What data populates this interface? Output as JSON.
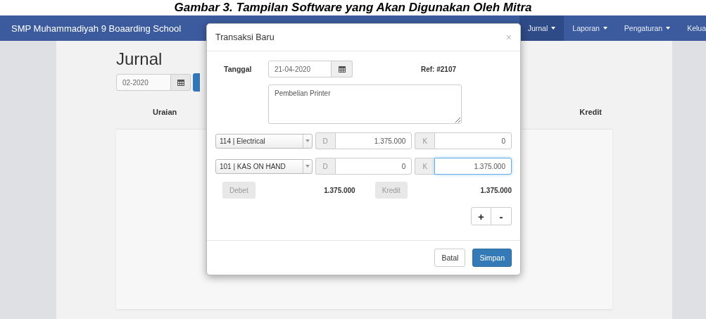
{
  "caption": "Gambar 3. Tampilan Software yang Akan Digunakan Oleh Mitra",
  "navbar": {
    "brand": "SMP Muhammadiyah 9 Boaarding School",
    "items": [
      {
        "label": "Jurnal",
        "caret": true,
        "selected": true
      },
      {
        "label": "Laporan",
        "caret": true,
        "selected": false
      },
      {
        "label": "Pengaturan",
        "caret": true,
        "selected": false
      },
      {
        "label": "Kelua",
        "caret": false,
        "selected": false
      }
    ]
  },
  "page": {
    "title": "Jurnal",
    "period": "02-2020",
    "columns": [
      "Uraian",
      "Kredit"
    ]
  },
  "modal": {
    "title": "Transaksi Baru",
    "close": "×",
    "date_label": "Tanggal",
    "date": "21-04-2020",
    "ref": "Ref: #2107",
    "description": "Pembelian Printer",
    "entries": [
      {
        "account": "114 | Electrical",
        "debit_label": "D",
        "debit": "1.375.000",
        "credit_label": "K",
        "credit": "0",
        "focused": false
      },
      {
        "account": "101 | KAS ON HAND",
        "debit_label": "D",
        "debit": "0",
        "credit_label": "K",
        "credit": "1.375.000",
        "focused": true
      }
    ],
    "totals": {
      "debit_button": {
        "label": "Debet",
        "disabled": true
      },
      "debit_total": "1.375.000",
      "credit_button": {
        "label": "Kredit",
        "disabled": true
      },
      "credit_total": "1.375.000"
    },
    "row_buttons": [
      "+",
      "-"
    ],
    "buttons": [
      {
        "label": "Batal",
        "kind": "default"
      },
      {
        "label": "Simpan",
        "kind": "primary"
      }
    ]
  }
}
